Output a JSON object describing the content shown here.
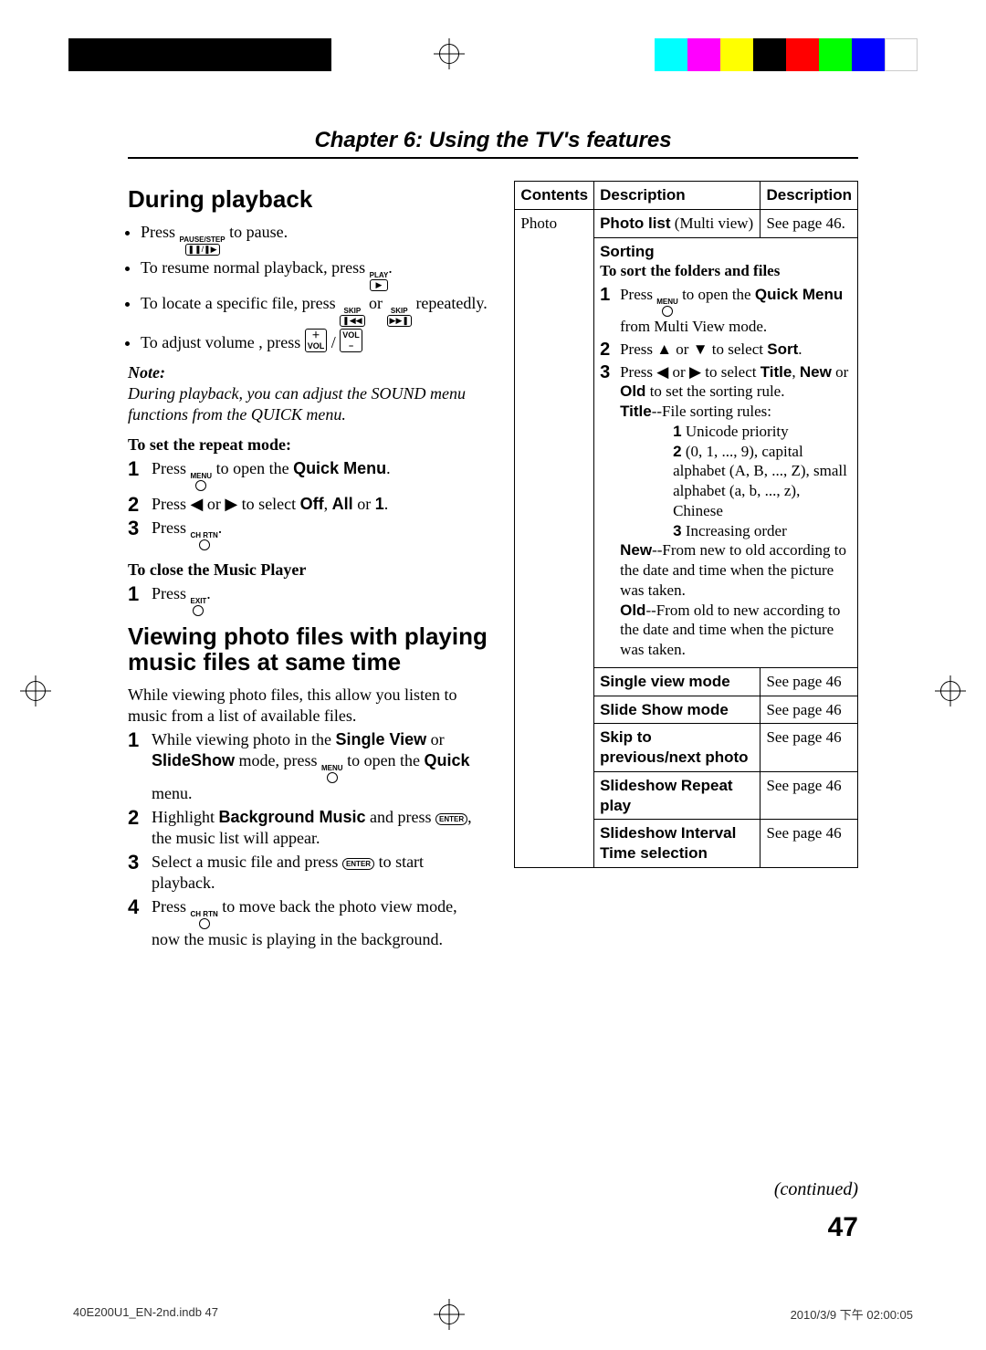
{
  "chapter": "Chapter 6: Using the TV's features",
  "left": {
    "h1": "During playback",
    "bul": {
      "b1a": "Press ",
      "b1b": " to pause.",
      "b2a": "To resume normal playback, press ",
      "b2b": ".",
      "b3a": "To locate a specific file, press ",
      "b3b": " or ",
      "b3c": " repeatedly.",
      "b4a": "To adjust volume , press ",
      "b4b": " / "
    },
    "note_lbl": "Note:",
    "note": "During playback, you can adjust the SOUND menu functions from the QUICK menu.",
    "repeat_h": "To set the repeat mode:",
    "r1a": "Press ",
    "r1b": " to open the ",
    "r1c": "Quick Menu",
    "r1d": ".",
    "r2a": "Press ◀ or ▶ to select ",
    "r2b": "Off",
    "r2c": ", ",
    "r2d": "All",
    "r2e": " or ",
    "r2f": "1",
    "r2g": ".",
    "r3a": "Press ",
    "close_h": "To close the Music Player",
    "c1a": "Press ",
    "h2": "Viewing photo files with playing music files at same time",
    "intro": "While viewing photo files, this allow you listen to music from a list of available files.",
    "s1a": "While viewing photo in the ",
    "s1b": "Single View",
    "s1c": " or ",
    "s1d": "SlideShow",
    "s1e": " mode, press ",
    "s1f": " to open the ",
    "s1g": "Quick",
    "s1h": " menu.",
    "s2a": "Highlight ",
    "s2b": "Background Music",
    "s2c": " and press ",
    "s2d": ", the music list will appear.",
    "s3a": "Select a music file and press ",
    "s3b": " to start playback.",
    "s4a": "Press ",
    "s4b": " to move back the photo view mode, now the music is playing in the background."
  },
  "keys": {
    "pause_lbl": "PAUSE/STEP",
    "pause_sym": "❚❚/❚▶",
    "play_lbl": "PLAY",
    "play_sym": "▶",
    "skip_lbl": "SKIP",
    "prev_sym": "❚◀◀",
    "next_sym": "▶▶❚",
    "volp": "＋",
    "volp2": "VOL",
    "volm": "VOL",
    "volm2": "−",
    "menu": "MENU",
    "chrtn": "CH RTN",
    "exit": "EXIT",
    "enter": "ENTER"
  },
  "table": {
    "th1": "Contents",
    "th2": "Description",
    "th3": "Description",
    "c_photo": "Photo",
    "r1a": "Photo list",
    "r1b": " (Multi view)",
    "r1p": "See page 46.",
    "sort_h": "Sorting",
    "sort_sub": "To sort the folders and files",
    "t1a": "Press ",
    "t1b": " to open the ",
    "t1c": "Quick Menu",
    "t1d": " from Multi View mode.",
    "t2a": "Press ▲ or ▼ to select ",
    "t2b": "Sort",
    "t2c": ".",
    "t3a": "Press ◀ or ▶ to select ",
    "t3b": "Title",
    "t3c": ", ",
    "t3d": "New",
    "t3e": " or ",
    "t3f": "Old",
    "t3g": " to set the sorting rule.",
    "title_lbl": "Title",
    "title_desc": "--File sorting rules:",
    "rule1b": "1",
    "rule1": " Unicode priority",
    "rule2b": "2",
    "rule2": " (0, 1, ..., 9), capital alphabet (A, B, ..., Z), small alphabet (a, b, ..., z), Chinese",
    "rule3b": "3",
    "rule3": " Increasing order",
    "new_lbl": "New",
    "new_desc": "--From new to old according to the date and time when the picture was taken.",
    "old_lbl": "Old",
    "old_desc": "--From old to new according to the date and time when the picture was taken.",
    "rSingle": "Single view mode",
    "rSingleP": "See page 46",
    "rSlide": "Slide Show mode",
    "rSlideP": "See page 46",
    "rSkip": "Skip to previous/next photo",
    "rSkipP": "See page 46",
    "rRepeat": "Slideshow Repeat play",
    "rRepeatP": "See page 46",
    "rInterval": "Slideshow Interval Time selection",
    "rIntervalP": "See page 46"
  },
  "continued": "(continued)",
  "page_num": "47",
  "footer_left": "40E200U1_EN-2nd.indb   47",
  "footer_right": "2010/3/9   下午 02:00:05"
}
